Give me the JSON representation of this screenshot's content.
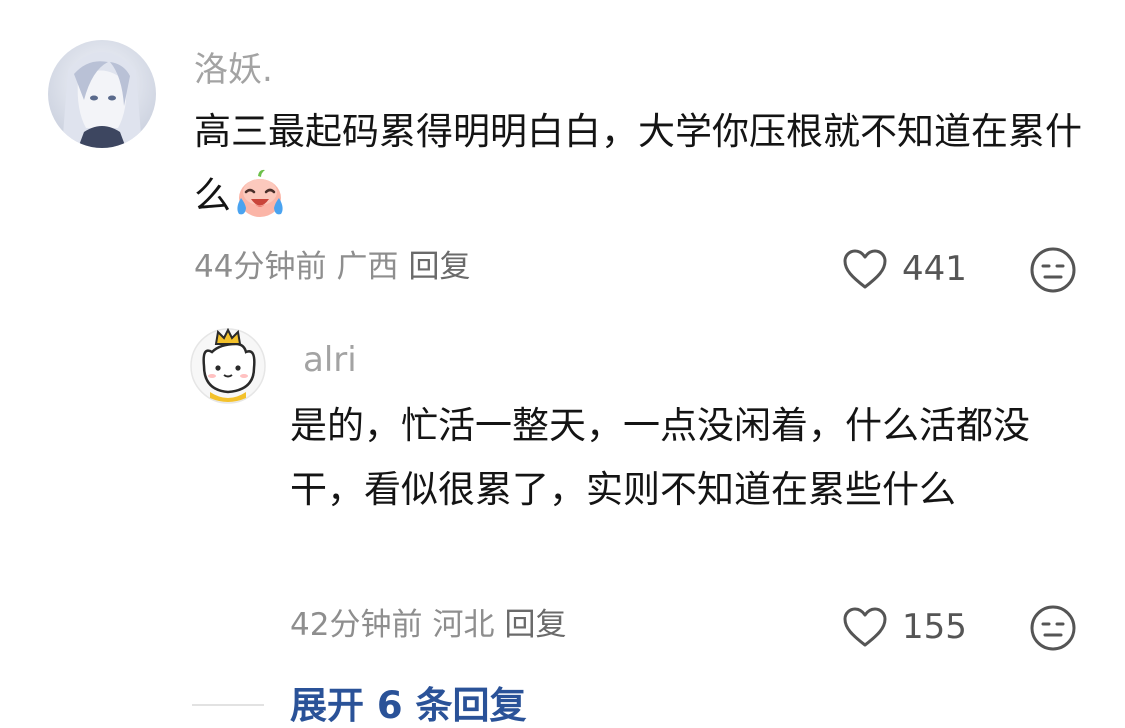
{
  "comments": [
    {
      "author": "洛妖.",
      "text": "高三最起码累得明明白白，大学你压根就不知道在累什么",
      "emoji": "crying-laughing-emoji",
      "time": "44分钟前",
      "location": "广西",
      "reply_label": "回复",
      "likes": "441"
    }
  ],
  "replies": [
    {
      "author": "alri",
      "text": "是的，忙活一整天，一点没闲着，什么活都没干，看似很累了，实则不知道在累些什么",
      "time": "42分钟前",
      "location": "河北",
      "reply_label": "回复",
      "likes": "155"
    }
  ],
  "expand_replies": "展开 6 条回复",
  "colors": {
    "link": "#2a5298",
    "meta": "#8e8e8e",
    "name": "#a3a3a3",
    "text": "#141414"
  }
}
